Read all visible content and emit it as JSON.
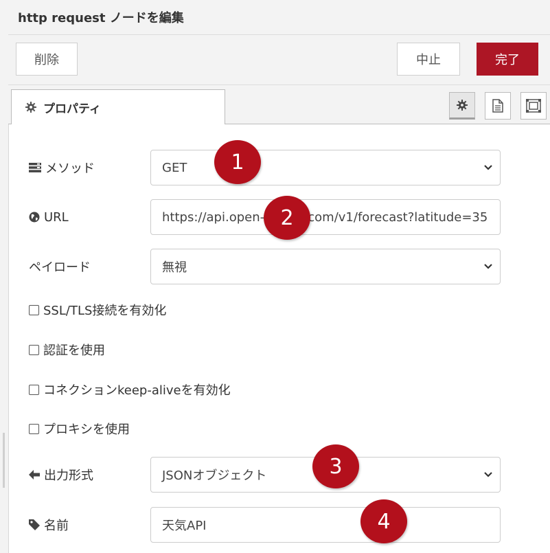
{
  "header": {
    "title": "http request ノードを編集"
  },
  "toolbar": {
    "delete_label": "削除",
    "cancel_label": "中止",
    "done_label": "完了"
  },
  "tabs": {
    "properties_label": "プロパティ"
  },
  "form": {
    "method": {
      "label": "メソッド",
      "value": "GET"
    },
    "url": {
      "label": "URL",
      "value": "https://api.open-meteo.com/v1/forecast?latitude=35"
    },
    "payload": {
      "label": "ペイロード",
      "value": "無視"
    },
    "checkboxes": {
      "ssl": "SSL/TLS接続を有効化",
      "auth": "認証を使用",
      "keepalive": "コネクションkeep-aliveを有効化",
      "proxy": "プロキシを使用"
    },
    "output": {
      "label": "出力形式",
      "value": "JSONオブジェクト"
    },
    "name": {
      "label": "名前",
      "value": "天気API"
    }
  },
  "badges": {
    "b1": "1",
    "b2": "2",
    "b3": "3",
    "b4": "4"
  },
  "colors": {
    "accent": "#ad1625",
    "badge": "#b3101c"
  },
  "icons": [
    "gear-icon",
    "document-icon",
    "frame-icon",
    "list-icon",
    "globe-icon",
    "arrow-left-icon",
    "tag-icon",
    "chevron-down-icon"
  ]
}
